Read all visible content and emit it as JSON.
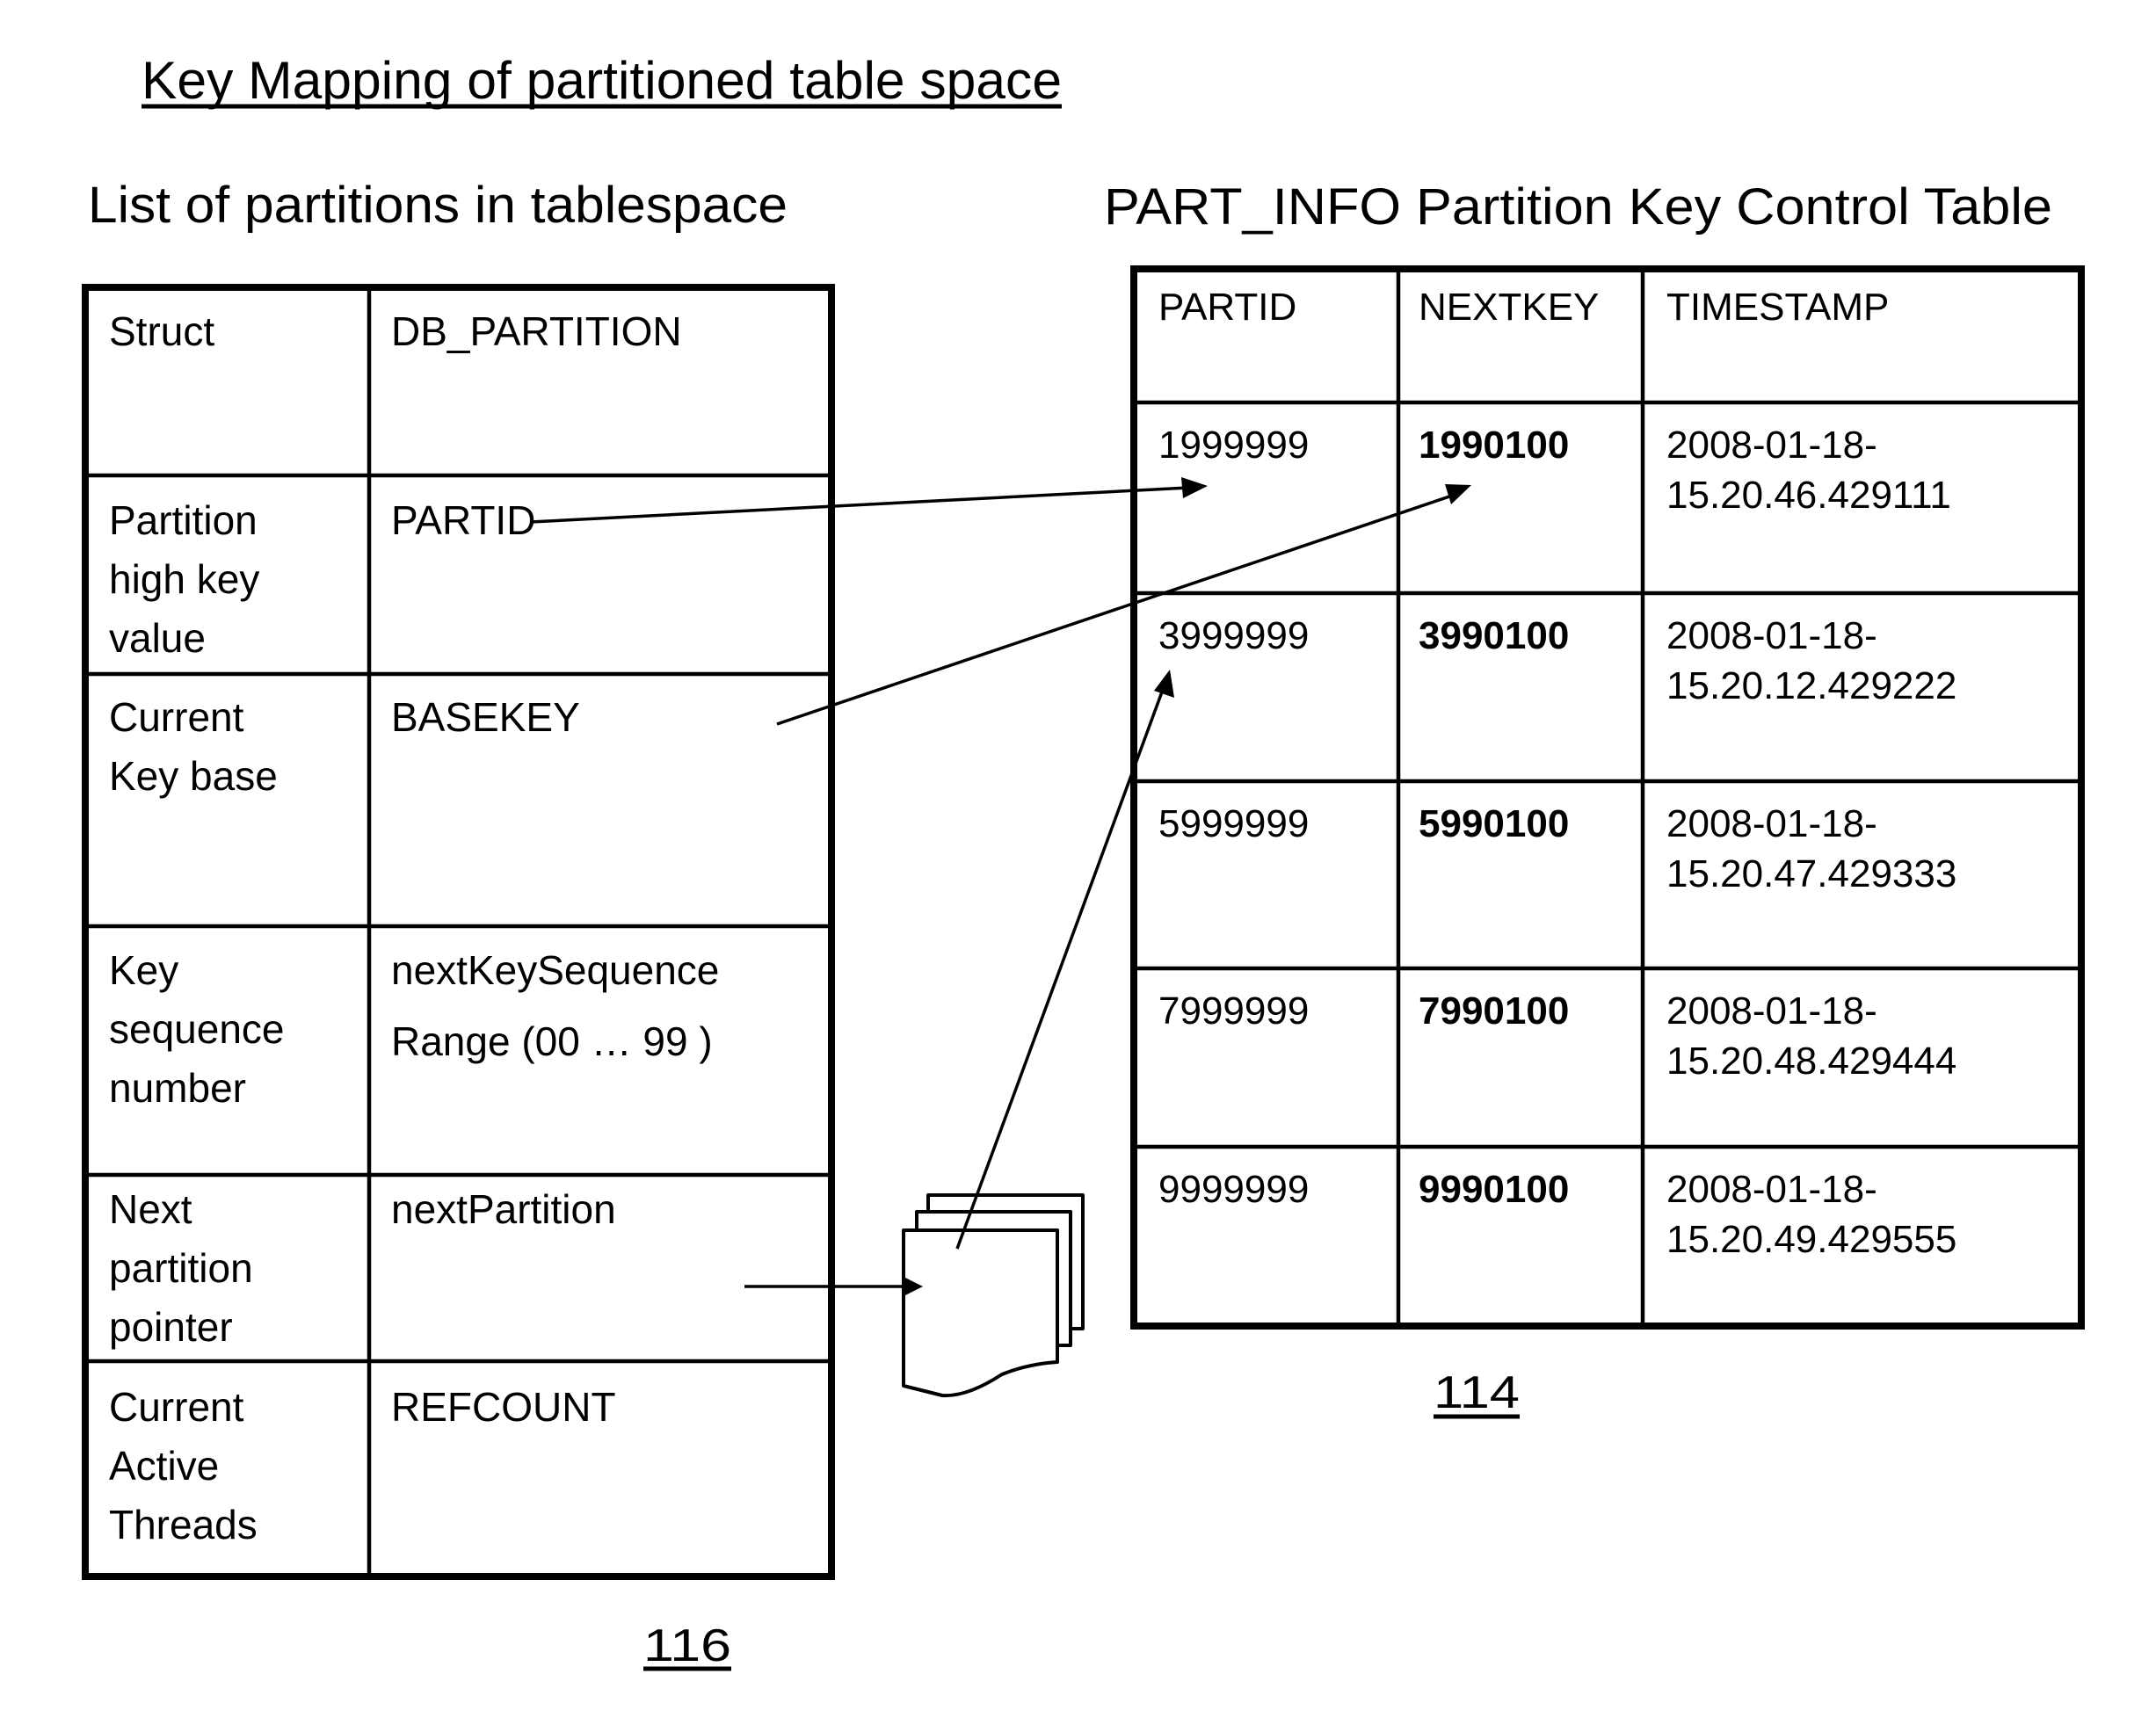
{
  "title": "Key Mapping of partitioned table space",
  "left_panel": {
    "heading": "List of partitions in tablespace",
    "reference_label": "116",
    "rows": [
      {
        "field": [
          "Struct"
        ],
        "value": [
          "DB_PARTITION"
        ]
      },
      {
        "field": [
          "Partition",
          "high key",
          "value"
        ],
        "value": [
          "PARTID"
        ]
      },
      {
        "field": [
          "Current",
          "Key base"
        ],
        "value": [
          "BASEKEY"
        ]
      },
      {
        "field": [
          "Key",
          "sequence",
          "number"
        ],
        "value": [
          "nextKeySequence",
          "Range (00 … 99 )"
        ]
      },
      {
        "field": [
          "Next",
          "partition",
          "pointer"
        ],
        "value": [
          "nextPartition"
        ]
      },
      {
        "field": [
          "Current",
          "Active",
          "Threads"
        ],
        "value": [
          "REFCOUNT"
        ]
      }
    ]
  },
  "right_panel": {
    "heading": "PART_INFO Partition Key Control Table",
    "reference_label": "114",
    "columns": [
      "PARTID",
      "NEXTKEY",
      "TIMESTAMP"
    ],
    "rows": [
      {
        "partid": "1999999",
        "nextkey": "1990100",
        "timestamp": [
          "2008-01-18-",
          "15.20.46.429111"
        ]
      },
      {
        "partid": "3999999",
        "nextkey": "3990100",
        "timestamp": [
          "2008-01-18-",
          "15.20.12.429222"
        ]
      },
      {
        "partid": "5999999",
        "nextkey": "5990100",
        "timestamp": [
          "2008-01-18-",
          "15.20.47.429333"
        ]
      },
      {
        "partid": "7999999",
        "nextkey": "7990100",
        "timestamp": [
          "2008-01-18-",
          "15.20.48.429444"
        ]
      },
      {
        "partid": "9999999",
        "nextkey": "9990100",
        "timestamp": [
          "2008-01-18-",
          "15.20.49.429555"
        ]
      }
    ]
  },
  "connectors": [
    {
      "from": "PARTID",
      "to": "PARTID column, row 1999999"
    },
    {
      "from": "BASEKEY",
      "to": "NEXTKEY column, row 1990100"
    },
    {
      "from": "nextPartition",
      "to": "partition-stack"
    },
    {
      "from": "partition-stack",
      "to": "PARTID column, row 3999999"
    }
  ],
  "icons": {
    "partition_stack": "document-stack-icon"
  }
}
